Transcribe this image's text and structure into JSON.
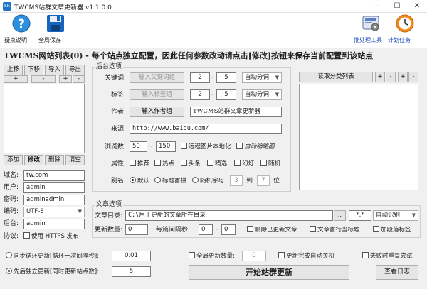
{
  "window": {
    "title": "TWCMS站群文章更新器 v1.1.0.0",
    "app_icon": "SR",
    "minimize": "—",
    "maximize": "☐",
    "close": "✕"
  },
  "toolbar": {
    "help": "疑点说明",
    "save_all": "全局保存",
    "batch_tool": "批处理工具",
    "scheduled": "计划任务"
  },
  "heading": "TWCMS网站列表(0) - 每个站点独立配置，因此任何参数改动请点击[修改]按钮来保存当前配置到该站点",
  "site_list": {
    "buttons_top": [
      "上移",
      "下移",
      "导入",
      "导出"
    ],
    "mini": [
      "+",
      "-",
      "+",
      "-"
    ],
    "buttons_bottom": [
      "添加",
      "修改",
      "删除",
      "清空"
    ],
    "fields": [
      {
        "label": "域名:",
        "value": "tw.com"
      },
      {
        "label": "用户:",
        "value": "admin"
      },
      {
        "label": "密码:",
        "value": "adminadmin"
      },
      {
        "label": "编码:",
        "value": "UTF-8"
      },
      {
        "label": "后台:",
        "value": "admin"
      }
    ],
    "protocol_label": "协议:",
    "https_label": "使用 HTTPS 发布"
  },
  "backend": {
    "title": "后台选项",
    "keyword_label": "关键词:",
    "keyword_btn": "输入关键词组",
    "keyword_min": "2",
    "keyword_max": "5",
    "keyword_mode": "自动分词",
    "tag_label": "标签:",
    "tag_btn": "输入标签组",
    "tag_min": "2",
    "tag_max": "5",
    "tag_mode": "自动分词",
    "author_label": "作者:",
    "author_btn": "输入作者组",
    "author_value": "TWCMS站群文章更新器",
    "source_label": "来源:",
    "source_value": "http://www.baidu.com/",
    "views_label": "浏览数:",
    "views_min": "50",
    "views_max": "150",
    "localize_label": "远程图片本地化",
    "thumb_label": "自动缩略图",
    "attr_label": "属性:",
    "attrs": [
      "推荐",
      "热点",
      "头条",
      "精选",
      "幻灯",
      "随机"
    ],
    "alias_label": "别名:",
    "alias_default": "默认",
    "alias_pinyin": "标题首拼",
    "alias_random": "随机字母",
    "alias_from": "3",
    "alias_to_label": "到",
    "alias_to": "7",
    "alias_unit": "位",
    "separator": "-"
  },
  "categories": {
    "read_btn": "读取分类列表",
    "mini": [
      "+",
      "-",
      "+",
      "-"
    ]
  },
  "article": {
    "title": "文章选项",
    "dir_label": "文章目录:",
    "dir_value": "C:\\用于更新的文章所在目录",
    "dir_btn": "..",
    "ext_value": "*.*",
    "encoding": "自动识别",
    "count_label": "更新数量:",
    "count_value": "0",
    "interval_label": "每篇间隔秒:",
    "interval_min": "0",
    "interval_max": "0",
    "delete_label": "删除已更新文章",
    "first_line_label": "文章首行当标题",
    "paragraph_label": "加段落标签"
  },
  "bottom": {
    "sync_label": "同步循环更新[循环一次间隔秒]:",
    "sync_value": "0.01",
    "indep_label": "先后独立更新[同时更新站点数]:",
    "indep_value": "5",
    "global_count_label": "全局更新数量:",
    "global_count_value": "0",
    "shutdown_label": "更新完成自动关机",
    "retry_label": "失败时重复尝试",
    "start_btn": "开始站群更新",
    "log_btn": "查看日志"
  },
  "colors": {
    "accent_blue": "#1f4fbf",
    "help_icon": "#2c8fe0",
    "save_icon": "#1565c0",
    "clock_icon": "#f28a1e"
  }
}
